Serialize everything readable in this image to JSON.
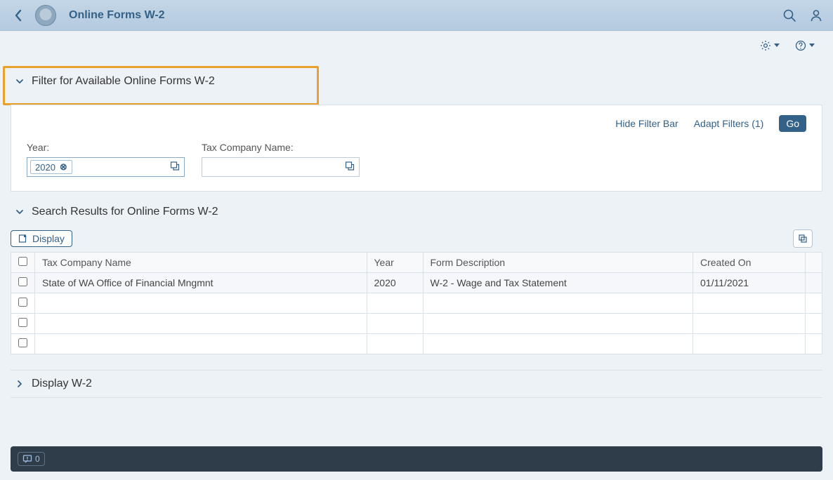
{
  "header": {
    "title": "Online Forms W-2"
  },
  "filter_section": {
    "title": "Filter for Available Online Forms W-2",
    "hide_filter_bar": "Hide Filter Bar",
    "adapt_filters": "Adapt Filters (1)",
    "go": "Go",
    "fields": {
      "year_label": "Year:",
      "year_token": "2020",
      "tax_company_label": "Tax Company Name:"
    }
  },
  "results_section": {
    "title": "Search Results for Online Forms W-2",
    "display_btn": "Display",
    "columns": {
      "tax_company": "Tax Company Name",
      "year": "Year",
      "form_desc": "Form Description",
      "created_on": "Created On"
    },
    "rows": [
      {
        "tax_company": "State of WA Office of Financial Mngmnt",
        "year": "2020",
        "form_desc": "W-2 - Wage and Tax Statement",
        "created_on": "01/11/2021"
      }
    ]
  },
  "display_section": {
    "title": "Display W-2"
  },
  "footer": {
    "msg_count": "0"
  }
}
